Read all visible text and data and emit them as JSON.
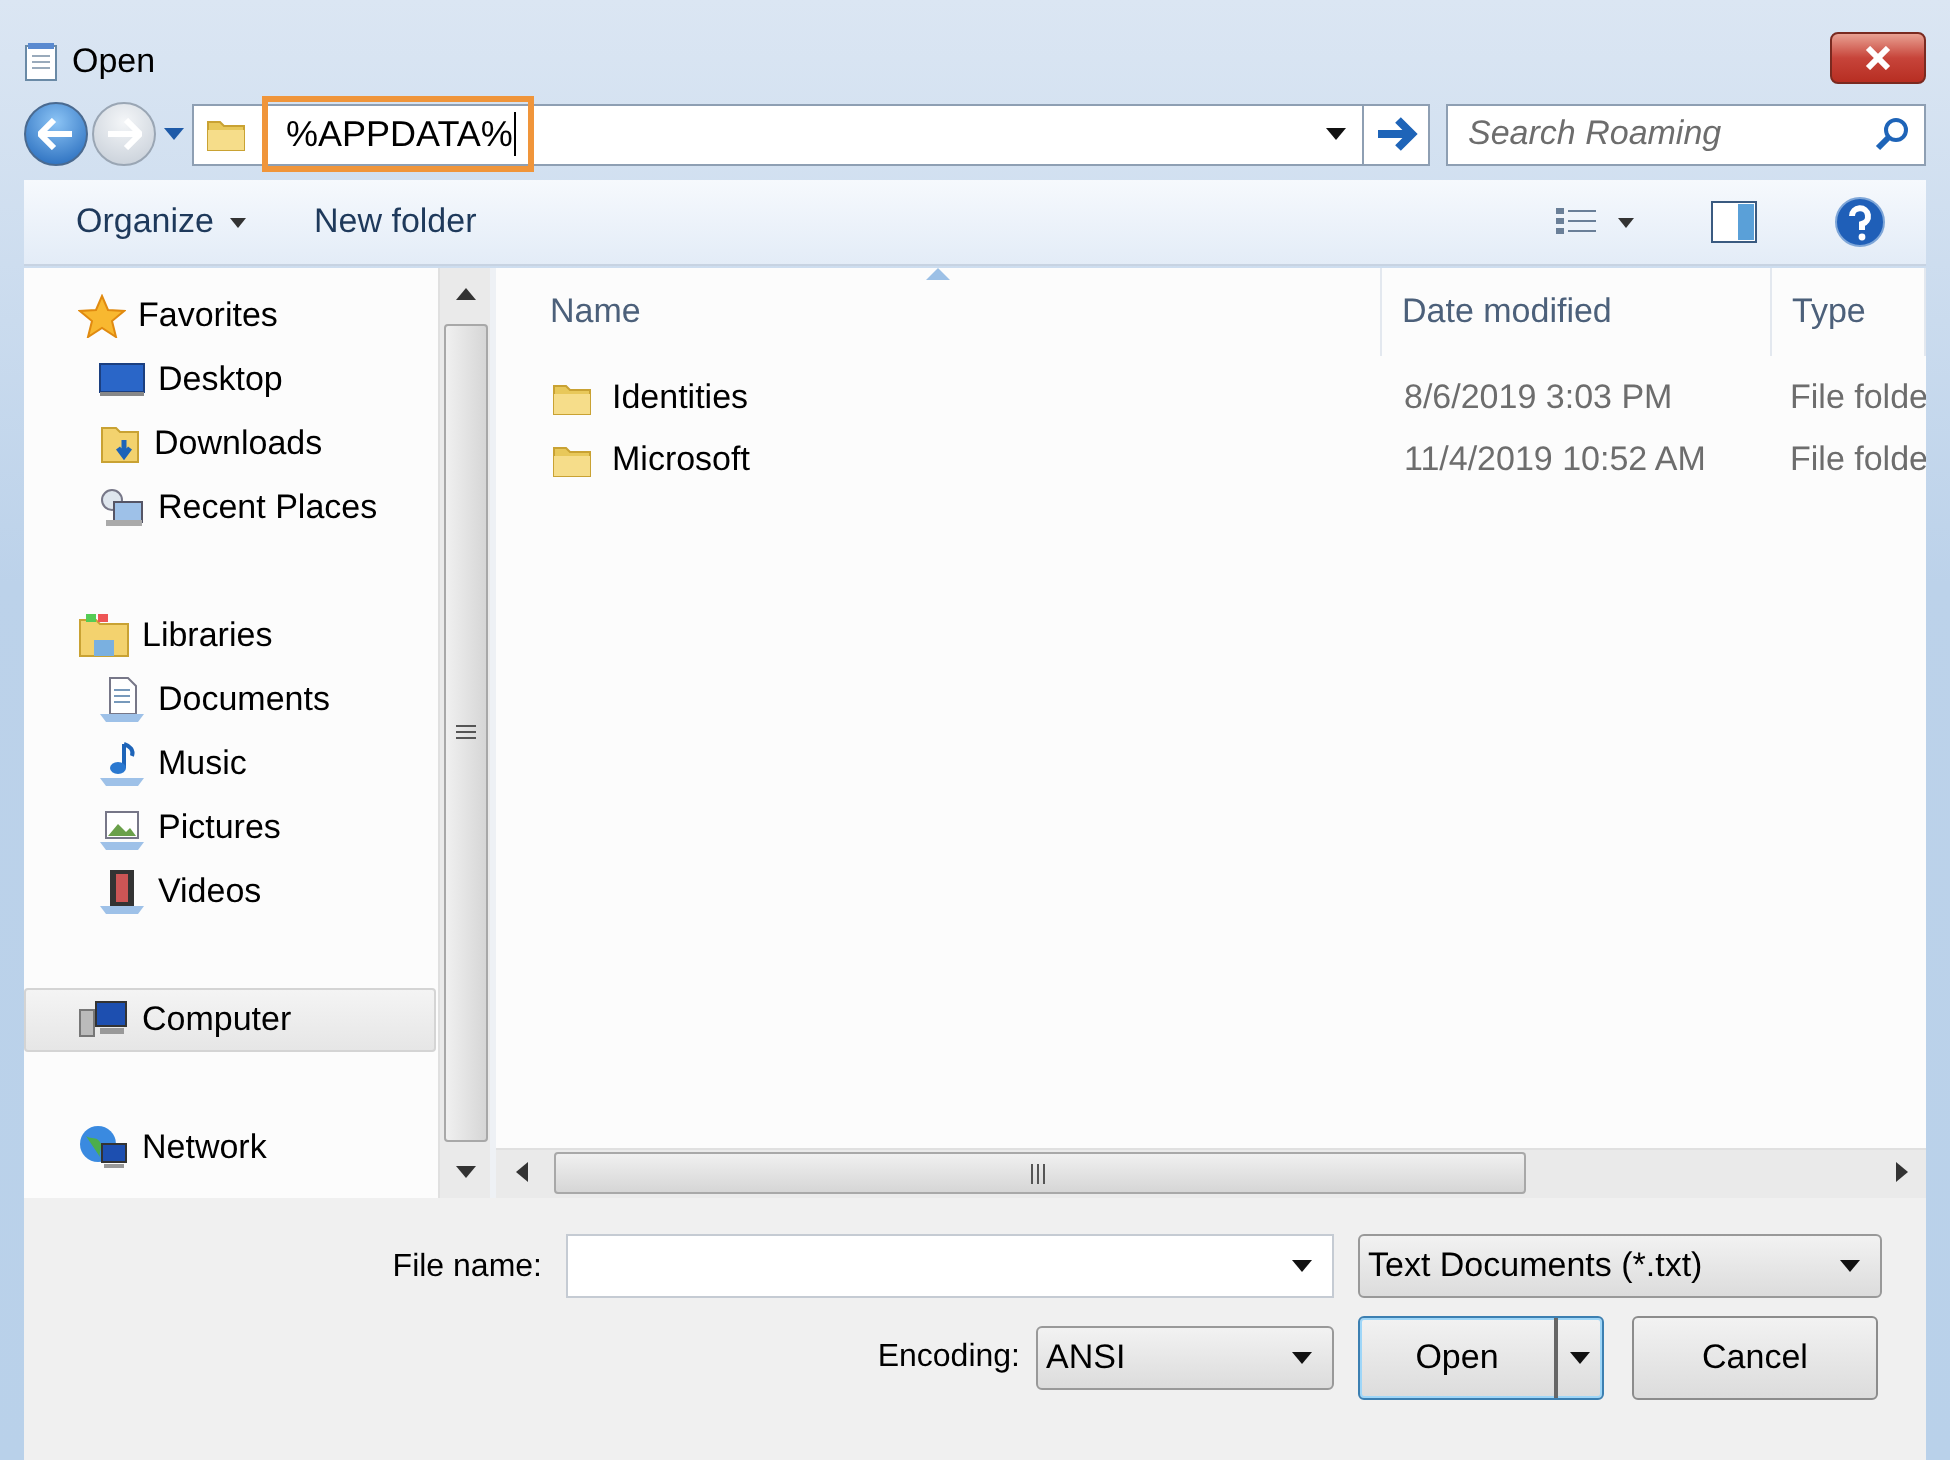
{
  "window": {
    "title": "Open"
  },
  "address": {
    "value": "%APPDATA%",
    "highlighted": true
  },
  "search": {
    "placeholder": "Search Roaming"
  },
  "toolbar": {
    "buttons": [
      {
        "label": "Organize",
        "kind": "menu"
      },
      {
        "label": "New folder",
        "kind": "plain"
      }
    ]
  },
  "nav": {
    "groups": [
      {
        "label": "Favorites",
        "selected": false,
        "children": [
          {
            "label": "Desktop",
            "selected": false
          },
          {
            "label": "Downloads",
            "selected": false
          },
          {
            "label": "Recent Places",
            "selected": false
          }
        ]
      },
      {
        "label": "Libraries",
        "selected": false,
        "children": [
          {
            "label": "Documents",
            "selected": false
          },
          {
            "label": "Music",
            "selected": false
          },
          {
            "label": "Pictures",
            "selected": false
          },
          {
            "label": "Videos",
            "selected": false
          }
        ]
      },
      {
        "label": "Computer",
        "selected": true
      },
      {
        "label": "Network",
        "selected": false
      }
    ]
  },
  "files": {
    "columns": [
      {
        "label": "Name",
        "sorted": true
      },
      {
        "label": "Date modified",
        "sorted": false
      },
      {
        "label": "Type",
        "sorted": false
      }
    ],
    "rows": [
      {
        "name": "Identities",
        "date": "8/6/2019 3:03 PM",
        "type": "File folde",
        "selected": false
      },
      {
        "name": "Microsoft",
        "date": "11/4/2019 10:52 AM",
        "type": "File folde",
        "selected": false
      }
    ]
  },
  "bottom": {
    "file_name": {
      "label": "File name:"
    },
    "file_type": {
      "value": "Text Documents (*.txt)"
    },
    "encoding": {
      "label": "Encoding:",
      "value": "ANSI"
    },
    "buttons": [
      {
        "label": "Open",
        "kind": "split",
        "default": true
      },
      {
        "label": "Cancel",
        "kind": "plain",
        "default": false
      }
    ]
  }
}
